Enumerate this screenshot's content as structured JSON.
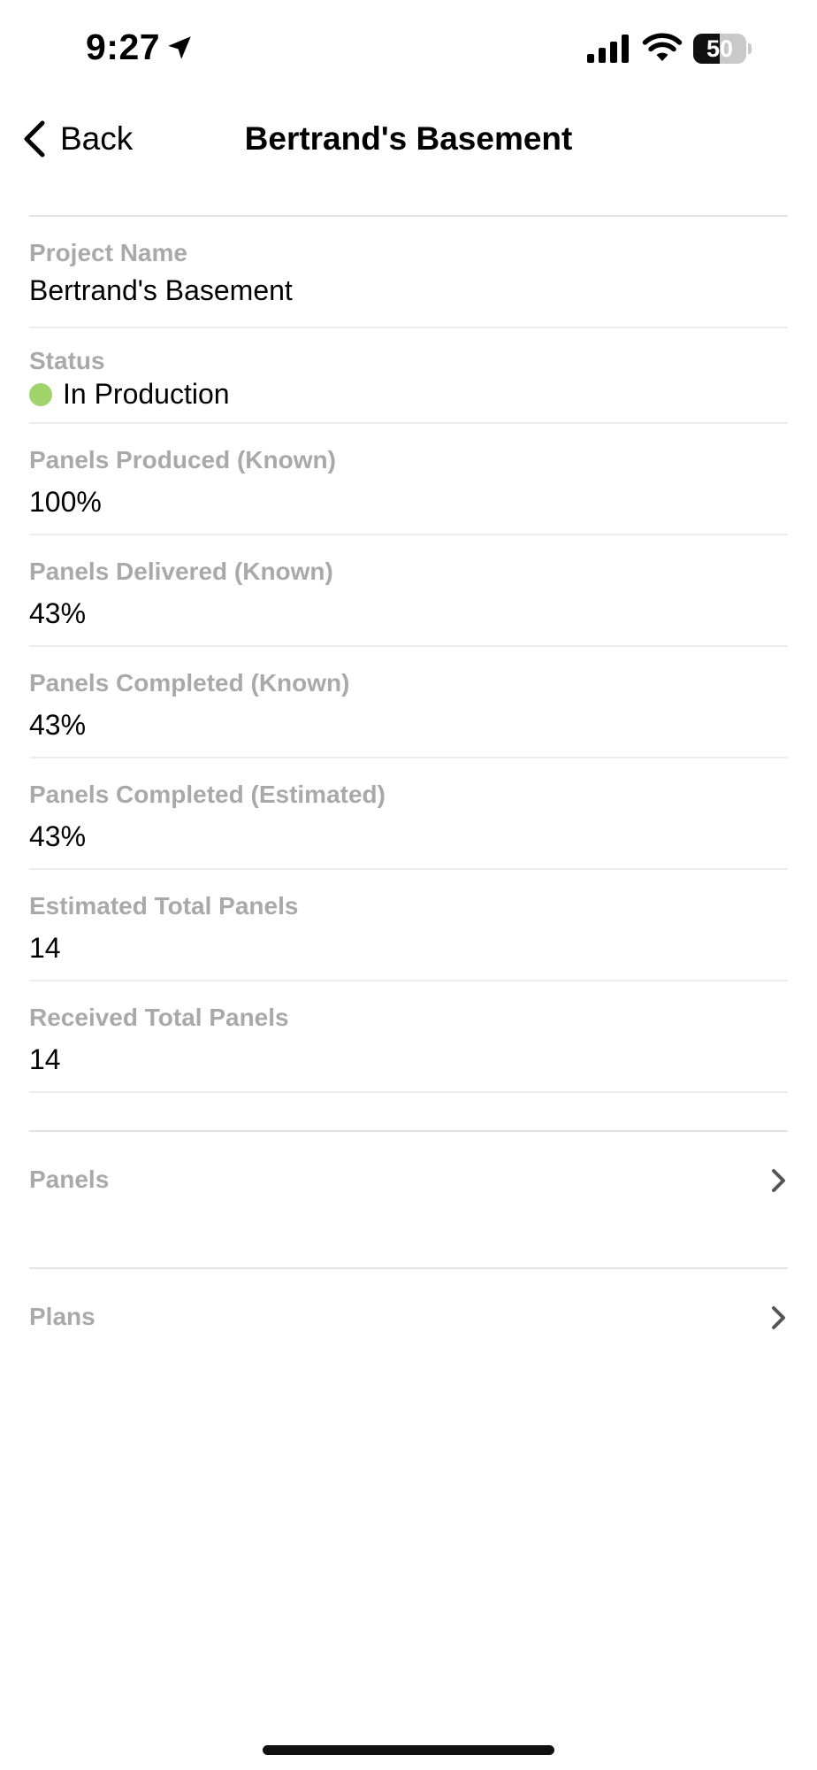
{
  "status_bar": {
    "time": "9:27",
    "battery_level": "50",
    "battery_fraction": 0.5
  },
  "nav": {
    "back_label": "Back",
    "title": "Bertrand's Basement"
  },
  "details": {
    "project_name": {
      "label": "Project Name",
      "value": "Bertrand's Basement"
    },
    "status": {
      "label": "Status",
      "value": "In Production",
      "dot_color": "#a1d36b"
    },
    "panels_produced_known": {
      "label": "Panels Produced (Known)",
      "value": "100%"
    },
    "panels_delivered_known": {
      "label": "Panels Delivered (Known)",
      "value": "43%"
    },
    "panels_completed_known": {
      "label": "Panels Completed (Known)",
      "value": "43%"
    },
    "panels_completed_estimated": {
      "label": "Panels Completed (Estimated)",
      "value": "43%"
    },
    "estimated_total_panels": {
      "label": "Estimated Total Panels",
      "value": "14"
    },
    "received_total_panels": {
      "label": "Received Total Panels",
      "value": "14"
    }
  },
  "links": {
    "panels": {
      "label": "Panels",
      "icon": "chevron-right-icon"
    },
    "plans": {
      "label": "Plans",
      "icon": "chevron-right-icon"
    }
  },
  "colors": {
    "label_gray": "#a9a9a9",
    "divider": "#e3e3e3",
    "status_green": "#a1d36b"
  }
}
